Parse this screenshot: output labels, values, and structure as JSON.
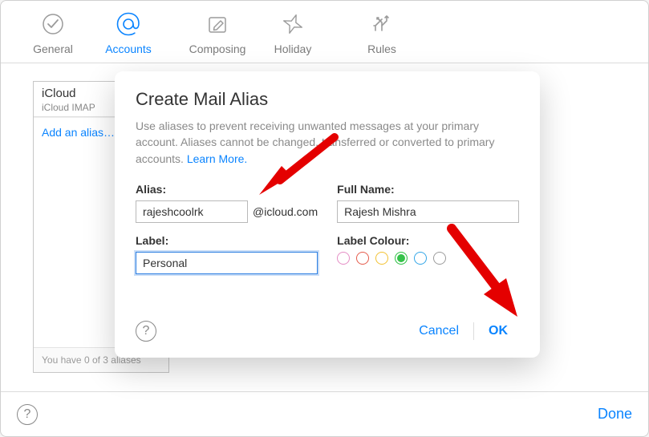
{
  "toolbar": {
    "items": [
      {
        "label": "General"
      },
      {
        "label": "Accounts"
      },
      {
        "label": "Composing"
      },
      {
        "label": "Holiday"
      },
      {
        "label": "Rules"
      }
    ]
  },
  "sidebar": {
    "account_title": "iCloud",
    "account_sub": "iCloud IMAP",
    "add_alias_label": "Add an alias…",
    "alias_count_text": "You have 0 of 3 aliases"
  },
  "modal": {
    "title": "Create Mail Alias",
    "description_part1": "Use aliases to prevent receiving unwanted messages at your primary account. Aliases cannot be changed, transferred or converted to primary accounts. ",
    "learn_more": "Learn More.",
    "alias_label": "Alias:",
    "alias_value": "rajeshcoolrk",
    "alias_suffix": "@icloud.com",
    "fullname_label": "Full Name:",
    "fullname_value": "Rajesh Mishra",
    "label_label": "Label:",
    "label_value": "Personal",
    "labelcolor_label": "Label Colour:",
    "colors": [
      "#e58dc5",
      "#e55b4b",
      "#f2c232",
      "#35c24a",
      "#33a6e7",
      "#9b9b9b"
    ],
    "selected_color_index": 3,
    "cancel": "Cancel",
    "ok": "OK"
  },
  "bottombar": {
    "done": "Done"
  }
}
